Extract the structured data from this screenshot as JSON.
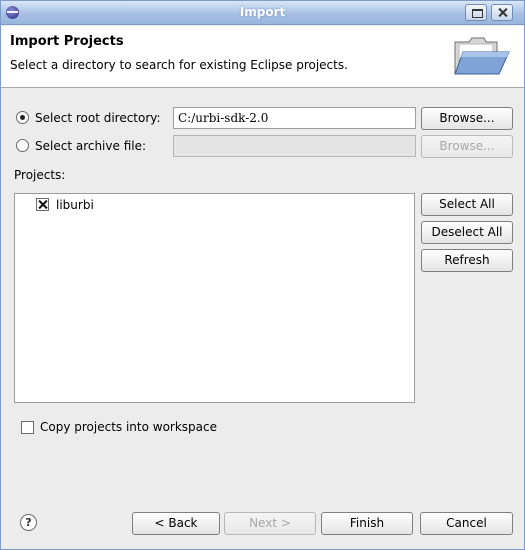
{
  "window": {
    "title": "Import"
  },
  "banner": {
    "heading": "Import Projects",
    "description": "Select a directory to search for existing Eclipse projects."
  },
  "source": {
    "root_directory": {
      "label": "Select root directory:",
      "value": "C:/urbi-sdk-2.0",
      "selected": true,
      "browse_label": "Browse..."
    },
    "archive_file": {
      "label": "Select archive file:",
      "value": "",
      "selected": false,
      "browse_label": "Browse..."
    }
  },
  "projects": {
    "label": "Projects:",
    "items": [
      {
        "name": "liburbi",
        "checked": true
      }
    ],
    "select_all_label": "Select All",
    "deselect_all_label": "Deselect All",
    "refresh_label": "Refresh"
  },
  "options": {
    "copy_label": "Copy projects into workspace",
    "copy_checked": false
  },
  "footer": {
    "help_label": "?",
    "back_label": "< Back",
    "next_label": "Next >",
    "finish_label": "Finish",
    "cancel_label": "Cancel"
  }
}
